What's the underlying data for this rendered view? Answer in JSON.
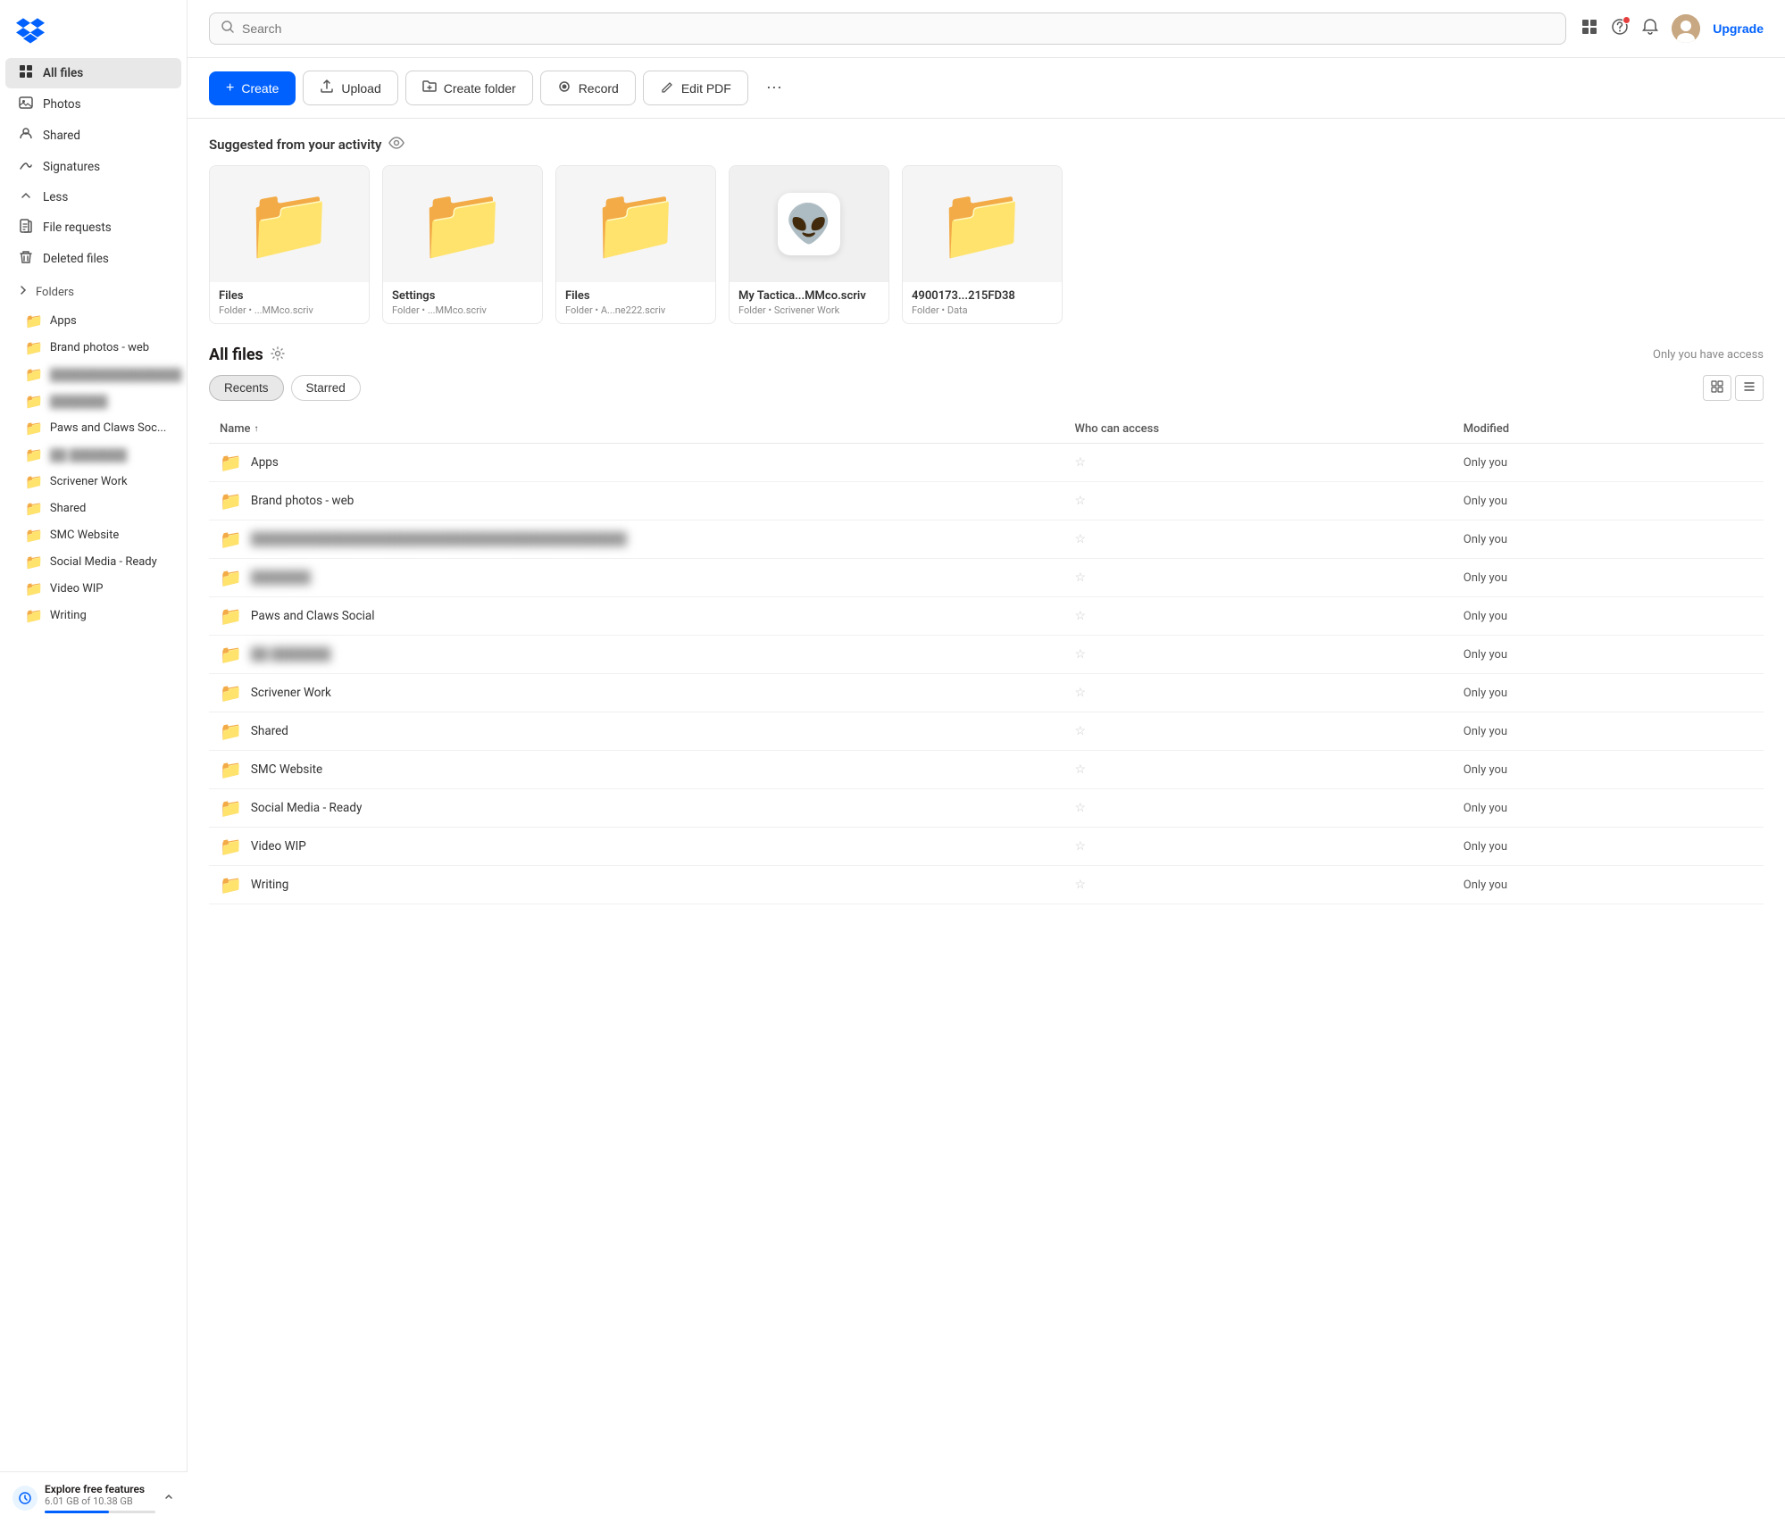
{
  "sidebar": {
    "logo_alt": "Dropbox",
    "nav_items": [
      {
        "label": "All files",
        "icon": "⊞",
        "active": true
      },
      {
        "label": "Photos",
        "icon": "🖼"
      },
      {
        "label": "Shared",
        "icon": "👥"
      },
      {
        "label": "Signatures",
        "icon": "✍"
      },
      {
        "label": "Less",
        "icon": "−"
      }
    ],
    "extra_items": [
      {
        "label": "File requests",
        "icon": "📋"
      },
      {
        "label": "Deleted files",
        "icon": "🗑"
      }
    ],
    "folders_header": "Folders",
    "folders": [
      {
        "label": "Apps"
      },
      {
        "label": "Brand photos - web"
      },
      {
        "label": "████████████████ ██"
      },
      {
        "label": "███████"
      },
      {
        "label": "Paws and Claws Soc..."
      },
      {
        "label": "██ ███████"
      },
      {
        "label": "Scrivener Work"
      },
      {
        "label": "Shared"
      },
      {
        "label": "SMC Website"
      },
      {
        "label": "Social Media - Ready"
      },
      {
        "label": "Video WIP"
      },
      {
        "label": "Writing"
      }
    ],
    "storage": {
      "label": "Explore free features",
      "sub": "6.01 GB of 10.38 GB"
    }
  },
  "header": {
    "search_placeholder": "Search",
    "upgrade_label": "Upgrade"
  },
  "toolbar": {
    "create_label": "Create",
    "upload_label": "Upload",
    "create_folder_label": "Create folder",
    "record_label": "Record",
    "edit_pdf_label": "Edit PDF"
  },
  "suggested": {
    "title": "Suggested from your activity",
    "cards": [
      {
        "name": "Files",
        "meta": "Folder • ...MMco.scriv",
        "type": "folder"
      },
      {
        "name": "Settings",
        "meta": "Folder • ...MMco.scriv",
        "type": "folder"
      },
      {
        "name": "Files",
        "meta": "Folder • A...ne222.scriv",
        "type": "folder"
      },
      {
        "name": "My Tactica...MMco.scriv",
        "meta": "Folder • Scrivener Work",
        "type": "alien"
      },
      {
        "name": "4900173...215FD38",
        "meta": "Folder • Data",
        "type": "folder"
      }
    ]
  },
  "all_files": {
    "title": "All files",
    "access_note": "Only you have access",
    "tabs": [
      {
        "label": "Recents",
        "active": true
      },
      {
        "label": "Starred",
        "active": false
      }
    ],
    "columns": {
      "name": "Name",
      "who_can_access": "Who can access",
      "modified": "Modified"
    },
    "rows": [
      {
        "name": "Apps",
        "blurred": false,
        "access": "Only you",
        "modified": "--"
      },
      {
        "name": "Brand photos - web",
        "blurred": false,
        "access": "Only you",
        "modified": "--"
      },
      {
        "name": "████████████████████████████████████████████████",
        "blurred": true,
        "access": "Only you",
        "modified": "--"
      },
      {
        "name": "███████",
        "blurred": true,
        "access": "Only you",
        "modified": "--"
      },
      {
        "name": "Paws and Claws Social",
        "blurred": false,
        "access": "Only you",
        "modified": "--"
      },
      {
        "name": "██ ███████",
        "blurred": true,
        "access": "Only you",
        "modified": "--"
      },
      {
        "name": "Scrivener Work",
        "blurred": false,
        "access": "Only you",
        "modified": "--"
      },
      {
        "name": "Shared",
        "blurred": false,
        "access": "Only you",
        "modified": "--"
      },
      {
        "name": "SMC Website",
        "blurred": false,
        "access": "Only you",
        "modified": "--"
      },
      {
        "name": "Social Media - Ready",
        "blurred": false,
        "access": "Only you",
        "modified": "--"
      },
      {
        "name": "Video WIP",
        "blurred": false,
        "access": "Only you",
        "modified": "--"
      },
      {
        "name": "Writing",
        "blurred": false,
        "access": "Only you",
        "modified": "--"
      }
    ]
  },
  "footer": {
    "writing_label": "Writing"
  }
}
